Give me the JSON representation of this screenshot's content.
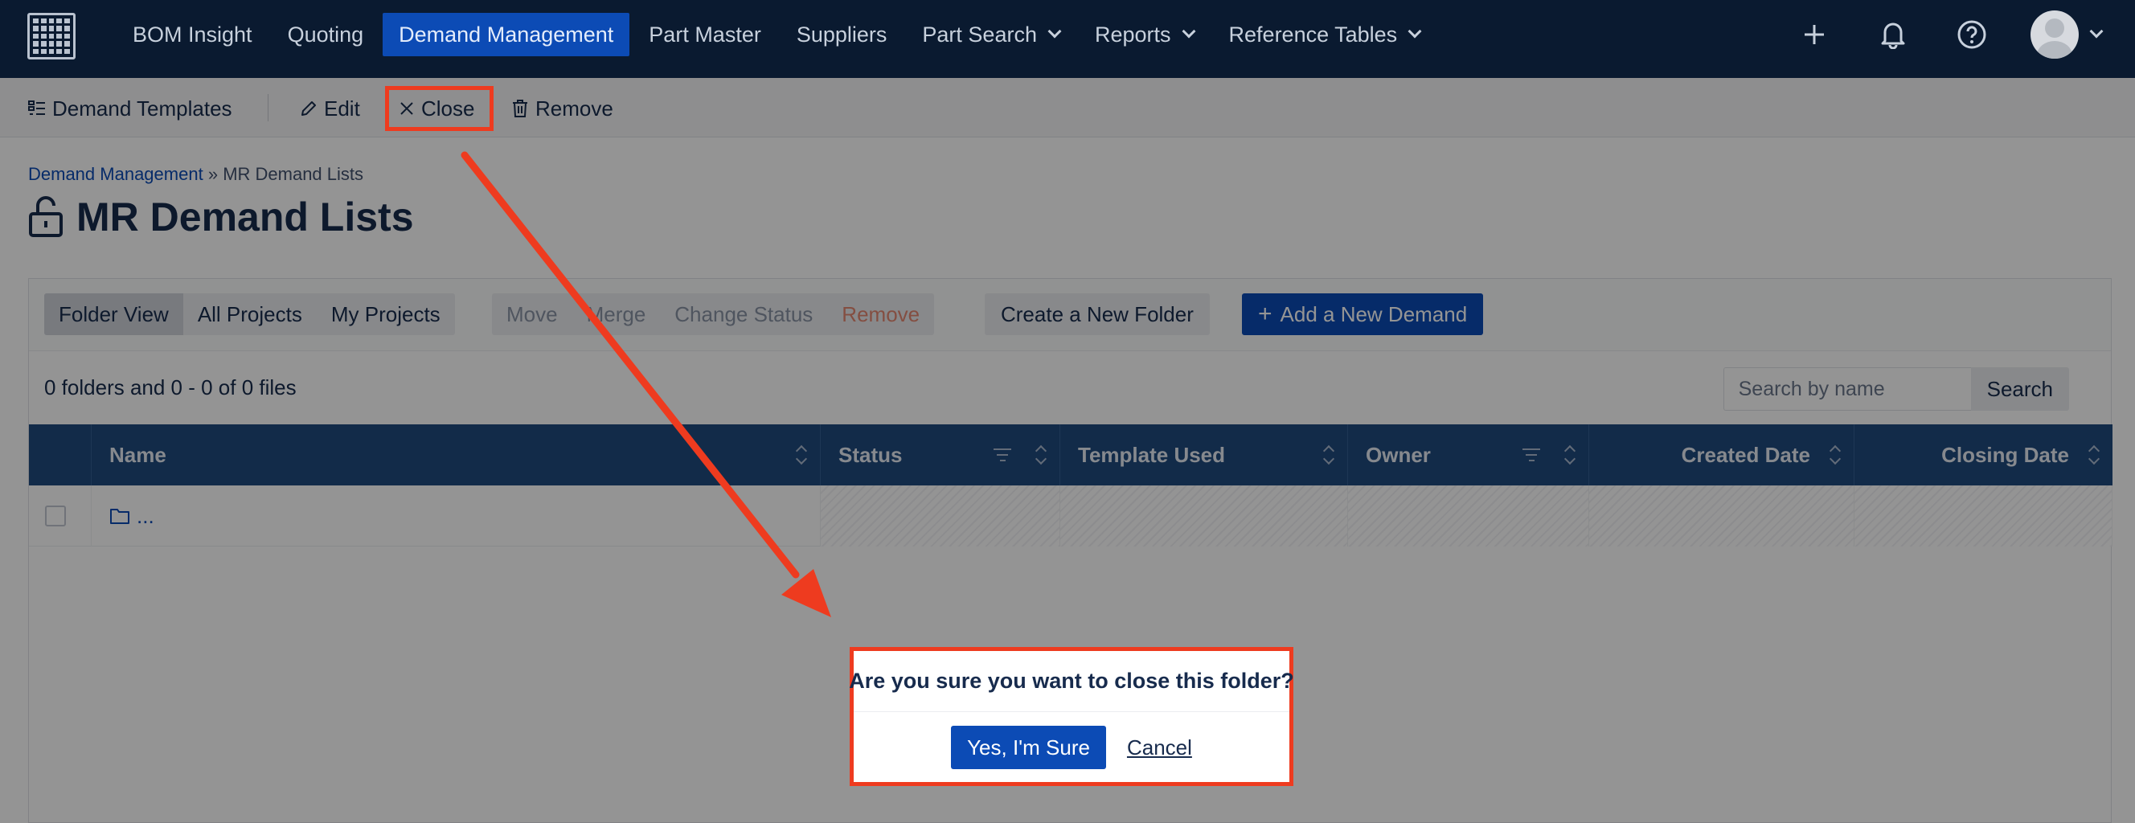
{
  "nav": {
    "items": [
      {
        "label": "BOM Insight",
        "dropdown": false,
        "active": false
      },
      {
        "label": "Quoting",
        "dropdown": false,
        "active": false
      },
      {
        "label": "Demand Management",
        "dropdown": false,
        "active": true
      },
      {
        "label": "Part Master",
        "dropdown": false,
        "active": false
      },
      {
        "label": "Suppliers",
        "dropdown": false,
        "active": false
      },
      {
        "label": "Part Search",
        "dropdown": true,
        "active": false
      },
      {
        "label": "Reports",
        "dropdown": true,
        "active": false
      },
      {
        "label": "Reference Tables",
        "dropdown": true,
        "active": false
      }
    ],
    "icons": [
      "plus-icon",
      "bell-icon",
      "help-icon",
      "avatar"
    ]
  },
  "toolbar": {
    "demand_templates": "Demand Templates",
    "edit": "Edit",
    "close": "Close",
    "remove": "Remove"
  },
  "breadcrumb": {
    "parent": "Demand Management",
    "separator": "»",
    "current": "MR Demand Lists"
  },
  "page": {
    "title": "MR Demand Lists",
    "title_icon": "unlock-icon"
  },
  "actions": {
    "views": [
      "Folder View",
      "All Projects",
      "My Projects"
    ],
    "active_view": "Folder View",
    "bulk": [
      "Move",
      "Merge",
      "Change Status",
      "Remove"
    ],
    "create_folder": "Create a New Folder",
    "add_demand": "Add a New Demand"
  },
  "summary": {
    "count_text": "0 folders and 0 - 0 of 0 files"
  },
  "search": {
    "placeholder": "Search by name",
    "button": "Search"
  },
  "grid": {
    "columns": [
      "Name",
      "Status",
      "Template Used",
      "Owner",
      "Created Date",
      "Closing Date"
    ],
    "rows": [
      {
        "name": "..."
      }
    ]
  },
  "dialog": {
    "message": "Are you sure you want to close this folder?",
    "confirm": "Yes, I'm Sure",
    "cancel": "Cancel"
  },
  "colors": {
    "nav_bg": "#0a1a30",
    "brand_blue": "#0c4bb5",
    "grid_header": "#1f4a7e",
    "annotation": "#ee3b1f"
  }
}
